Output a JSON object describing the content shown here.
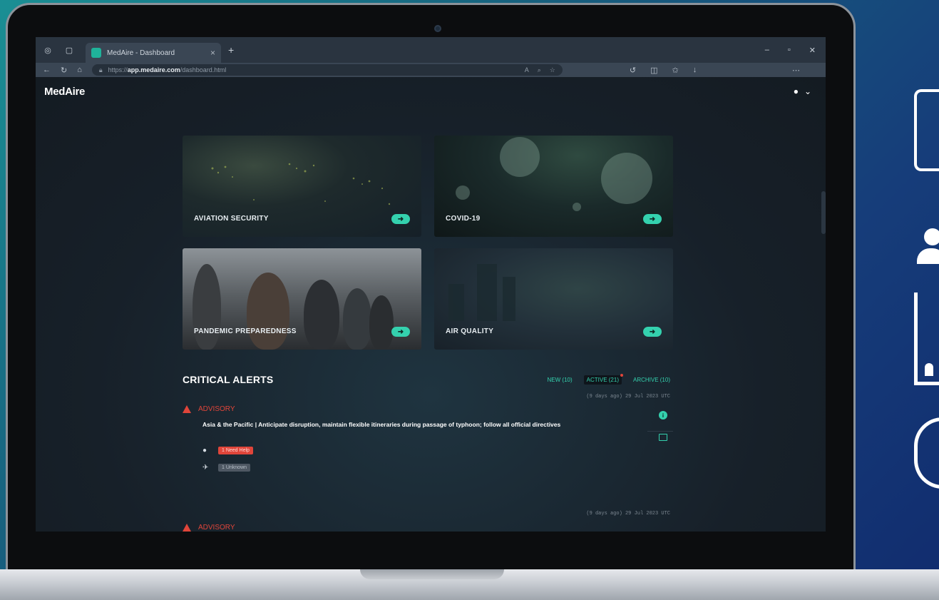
{
  "browser": {
    "tab_title": "MedAire - Dashboard",
    "url_prefix": "https://",
    "url_host": "app.medaire.com",
    "url_path": "/dashboard.html"
  },
  "app": {
    "logo": "MedAire"
  },
  "tiles": [
    {
      "label": "AVIATION SECURITY",
      "icon": "arrow-right-icon"
    },
    {
      "label": "COVID-19",
      "icon": "arrow-right-icon"
    },
    {
      "label": "PANDEMIC PREPAREDNESS",
      "icon": "arrow-right-icon"
    },
    {
      "label": "AIR QUALITY",
      "icon": "arrow-right-icon"
    }
  ],
  "alerts": {
    "title": "CRITICAL ALERTS",
    "tabs": [
      "NEW (10)",
      "ACTIVE (21)",
      "ARCHIVE (10)"
    ],
    "items": [
      {
        "time": "(9 days ago) 29 Jul 2023 UTC",
        "type": "ADVISORY",
        "text": "Asia & the Pacific | Anticipate disruption, maintain flexible itineraries during passage of typhoon; follow all official directives",
        "badge_need_help": "1 Need Help",
        "badge_unknown": "1 Unknown"
      },
      {
        "time": "(9 days ago) 29 Jul 2023 UTC",
        "type": "ADVISORY"
      }
    ]
  },
  "colors": {
    "accent": "#34d1ae",
    "alert_red": "#e0453a",
    "background": "#1b2530"
  }
}
